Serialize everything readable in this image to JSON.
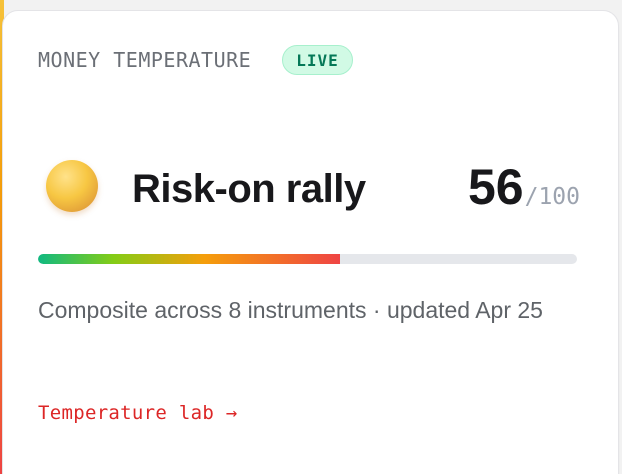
{
  "card": {
    "eyebrow": "MONEY TEMPERATURE",
    "live_badge": "LIVE",
    "state_label": "Risk-on rally",
    "score": "56",
    "score_max": "/100",
    "temperature_fraction": 0.56,
    "description": "Composite across 8 instruments · updated Apr 25",
    "link_label": "Temperature lab →"
  },
  "colors": {
    "badge_bg": "#d1fae5",
    "badge_text": "#047857",
    "link": "#dc2626",
    "bar_gradient": [
      "#10b981",
      "#f59e0b",
      "#ef4444"
    ],
    "track": "#e5e7eb"
  },
  "icons": {
    "state_icon": "sun-orb-icon",
    "link_arrow": "arrow-right-icon"
  }
}
